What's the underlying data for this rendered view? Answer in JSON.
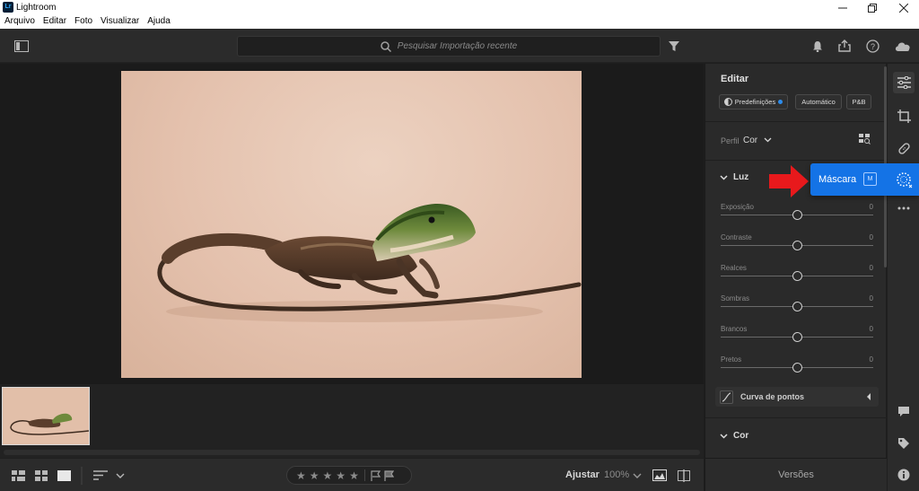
{
  "window": {
    "app_icon_text": "Lr",
    "title": "Lightroom"
  },
  "menubar": {
    "items": [
      "Arquivo",
      "Editar",
      "Foto",
      "Visualizar",
      "Ajuda"
    ]
  },
  "search": {
    "placeholder": "Pesquisar Importação recente"
  },
  "bottombar": {
    "fit_label": "Ajustar",
    "zoom_value": "100%"
  },
  "edit_panel": {
    "title": "Editar",
    "presets_label": "Predefinições",
    "auto_label": "Automático",
    "bw_label": "P&B",
    "profile_label": "Perfil",
    "profile_value": "Cor",
    "light_section": "Luz",
    "sliders": [
      {
        "name": "Exposição",
        "value": "0"
      },
      {
        "name": "Contraste",
        "value": "0"
      },
      {
        "name": "Realces",
        "value": "0"
      },
      {
        "name": "Sombras",
        "value": "0"
      },
      {
        "name": "Brancos",
        "value": "0"
      },
      {
        "name": "Pretos",
        "value": "0"
      }
    ],
    "curve_label": "Curva de pontos",
    "color_section": "Cor",
    "versions_label": "Versões"
  },
  "mask_popup": {
    "label": "Máscara",
    "shortcut": "M"
  },
  "colors": {
    "accent": "#1473e6",
    "arrow": "#e8191c"
  }
}
